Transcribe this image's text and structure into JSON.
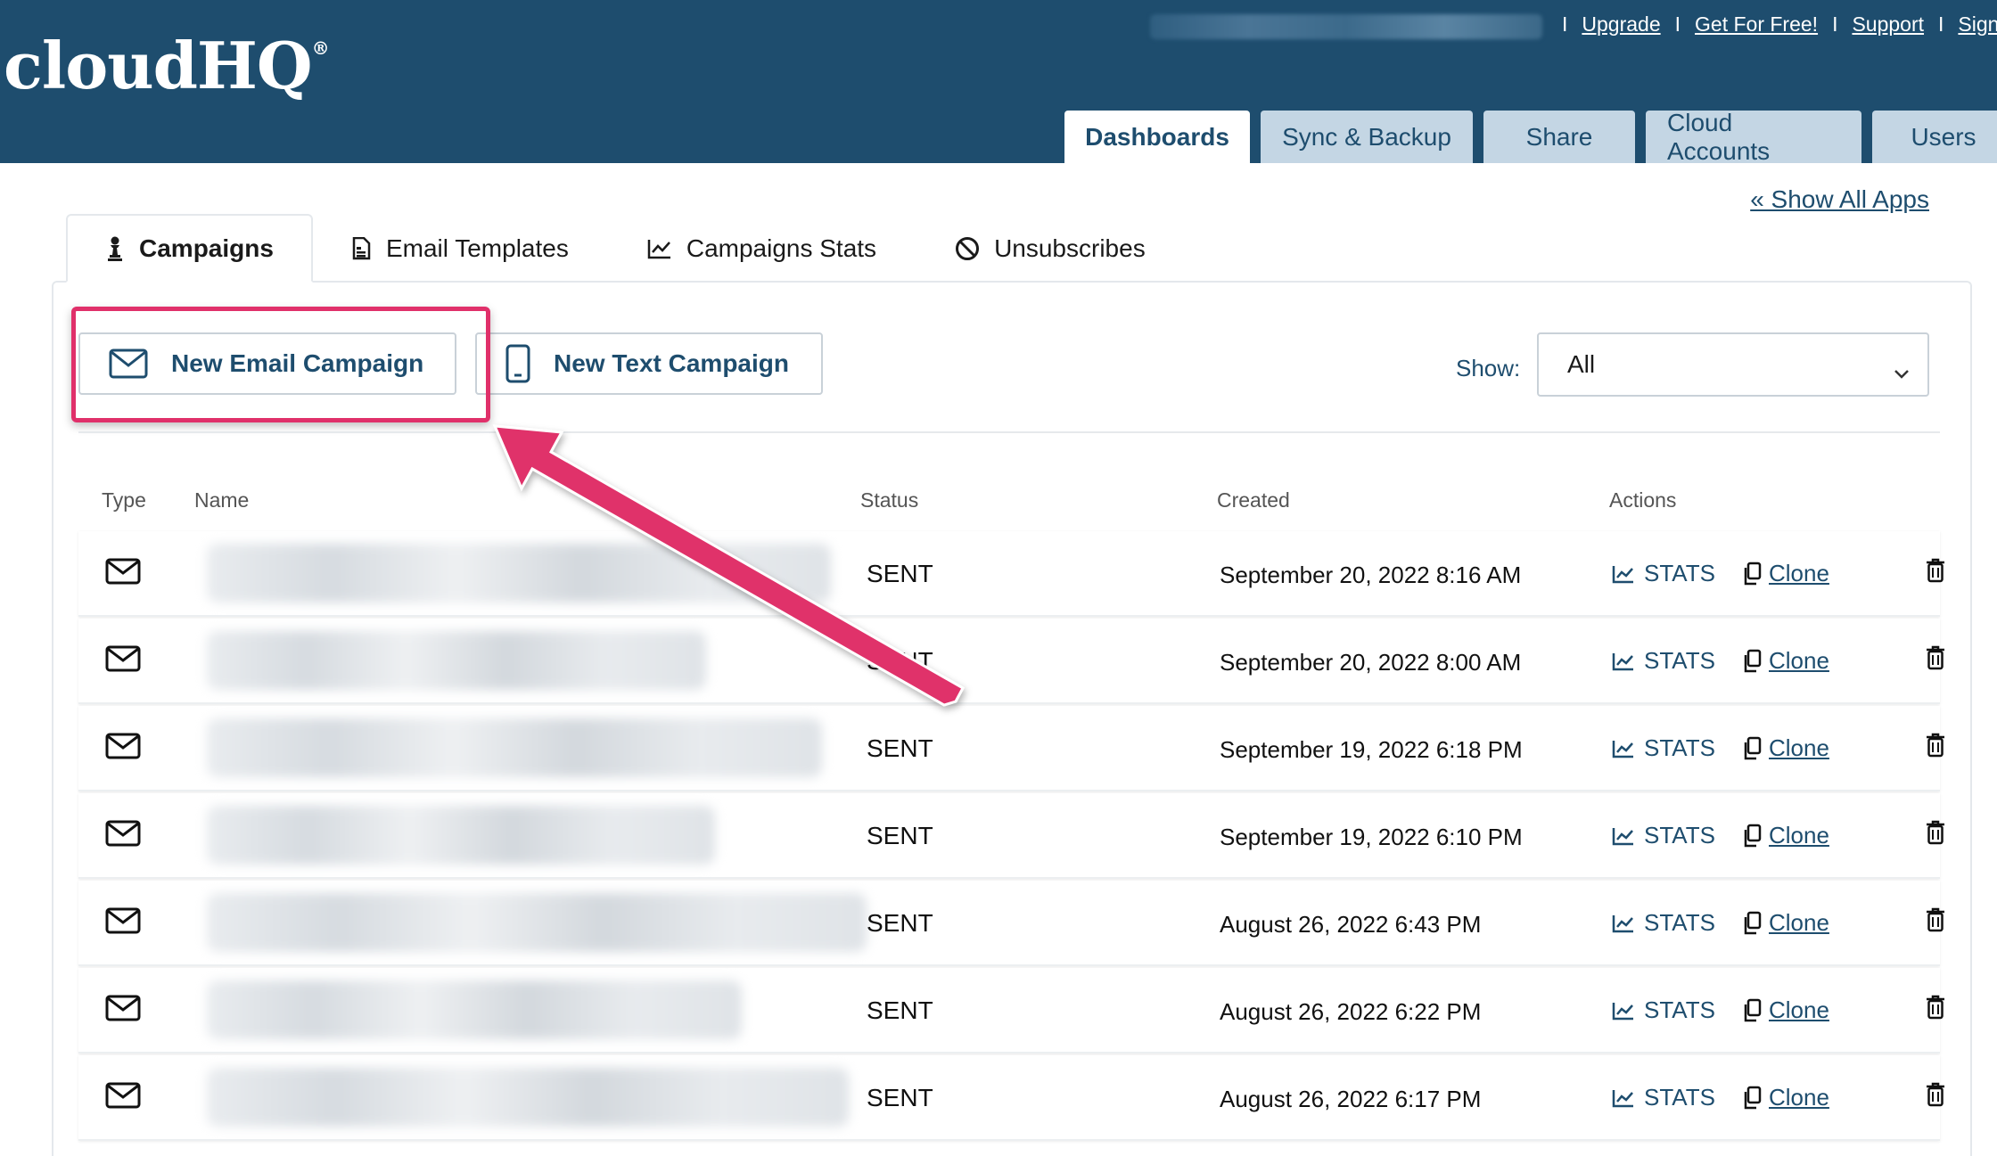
{
  "header": {
    "logo": "cloudHQ",
    "logo_mark": "®",
    "links": [
      "Upgrade",
      "Get For Free!",
      "Support",
      "Sign O"
    ],
    "separator": "I",
    "tabs": [
      "Dashboards",
      "Sync & Backup",
      "Share",
      "Cloud Accounts",
      "Users"
    ],
    "active_tab": "Dashboards"
  },
  "show_all_apps": "« Show All Apps",
  "subtabs": [
    {
      "label": "Campaigns",
      "icon": "chess-pawn-icon"
    },
    {
      "label": "Email Templates",
      "icon": "document-icon"
    },
    {
      "label": "Campaigns Stats",
      "icon": "chart-line-icon"
    },
    {
      "label": "Unsubscribes",
      "icon": "ban-icon"
    }
  ],
  "actions": {
    "new_email": "New Email Campaign",
    "new_text": "New Text Campaign",
    "show_label": "Show:",
    "show_value": "All"
  },
  "table": {
    "headers": [
      "Type",
      "Name",
      "Status",
      "Created",
      "Actions"
    ],
    "stats_label": "STATS",
    "clone_label": "Clone",
    "rows": [
      {
        "status": "SENT",
        "created": "September 20, 2022 8:16 AM"
      },
      {
        "status": "SENT",
        "created": "September 20, 2022 8:00 AM"
      },
      {
        "status": "SENT",
        "created": "September 19, 2022 6:18 PM"
      },
      {
        "status": "SENT",
        "created": "September 19, 2022 6:10 PM"
      },
      {
        "status": "SENT",
        "created": "August 26, 2022 6:43 PM"
      },
      {
        "status": "SENT",
        "created": "August 26, 2022 6:22 PM"
      },
      {
        "status": "SENT",
        "created": "August 26, 2022 6:17 PM"
      }
    ]
  },
  "colors": {
    "header_bg": "#1e4d6e",
    "accent": "#1e4d6e",
    "highlight": "#e0306a",
    "tab_inactive": "#c4d6e4"
  }
}
